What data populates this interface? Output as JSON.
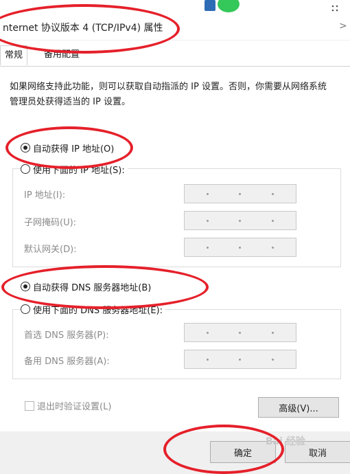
{
  "window": {
    "title": "nternet 协议版本 4 (TCP/IPv4) 属性",
    "title_chevron": ">"
  },
  "tabs": [
    {
      "label": "常规",
      "active": true
    },
    {
      "label": "备用配置",
      "active": false
    }
  ],
  "description": "如果网络支持此功能，则可以获取自动指派的 IP 设置。否则，你需要从网络系统管理员处获得适当的 IP 设置。",
  "ip_options": {
    "auto": {
      "label": "自动获得 IP 地址(O)",
      "checked": true
    },
    "manual": {
      "label": "使用下面的 IP 地址(S):",
      "checked": false
    },
    "fields": [
      {
        "label": "IP 地址(I):"
      },
      {
        "label": "子网掩码(U):"
      },
      {
        "label": "默认网关(D):"
      }
    ]
  },
  "dns_options": {
    "auto": {
      "label": "自动获得 DNS 服务器地址(B)",
      "checked": true
    },
    "manual": {
      "label": "使用下面的 DNS 服务器地址(E):",
      "checked": false
    },
    "fields": [
      {
        "label": "首选 DNS 服务器(P):"
      },
      {
        "label": "备用 DNS 服务器(A):"
      }
    ]
  },
  "validate_on_exit": {
    "label": "退出时验证设置(L)",
    "checked": false
  },
  "buttons": {
    "advanced": "高级(V)...",
    "ok": "确定",
    "cancel": "取消"
  },
  "watermark": "Bai 经验",
  "annotation_color": "#e5202a"
}
